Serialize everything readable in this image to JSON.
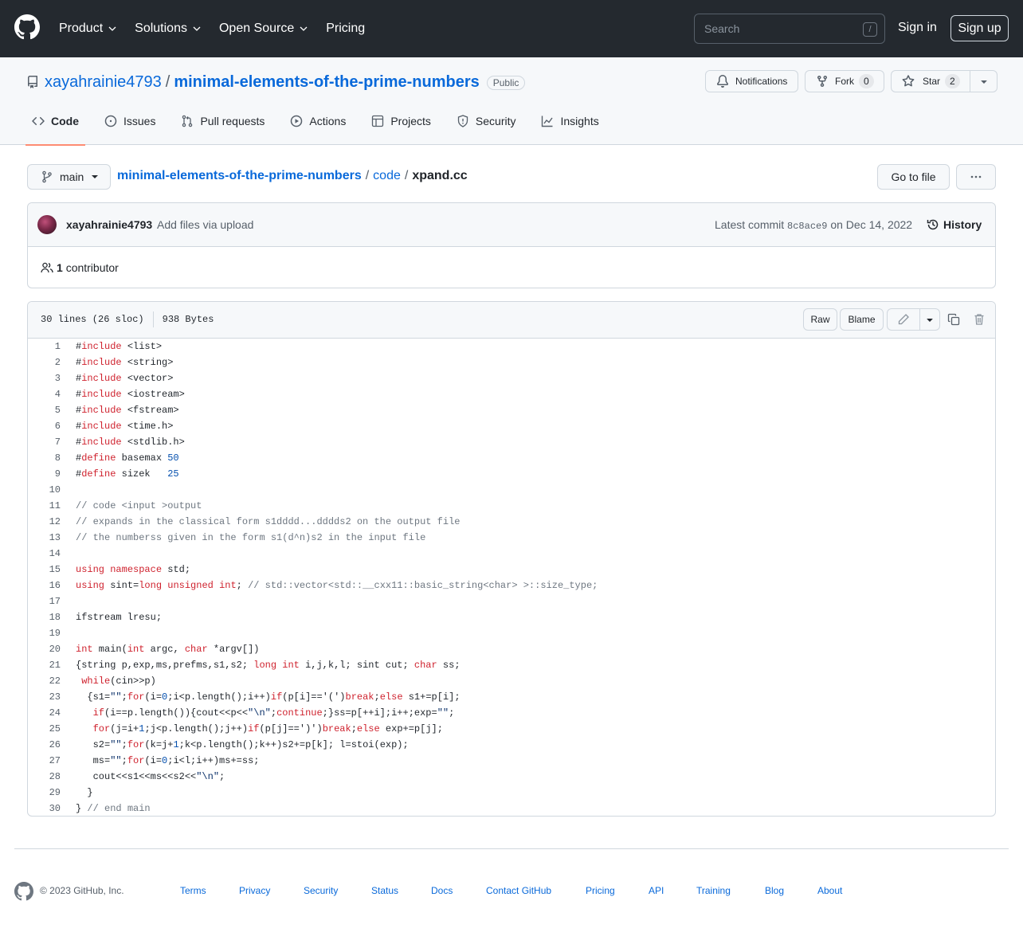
{
  "header": {
    "nav": [
      "Product",
      "Solutions",
      "Open Source",
      "Pricing"
    ],
    "search_placeholder": "Search",
    "search_shortcut": "/",
    "signin": "Sign in",
    "signup": "Sign up"
  },
  "repo": {
    "owner": "xayahrainie4793",
    "separator": "/",
    "name": "minimal-elements-of-the-prime-numbers",
    "visibility": "Public",
    "notifications": "Notifications",
    "fork_label": "Fork",
    "fork_count": "0",
    "star_label": "Star",
    "star_count": "2",
    "tabs": [
      {
        "label": "Code",
        "icon": "code-icon"
      },
      {
        "label": "Issues",
        "icon": "issue-icon"
      },
      {
        "label": "Pull requests",
        "icon": "pull-request-icon"
      },
      {
        "label": "Actions",
        "icon": "play-icon"
      },
      {
        "label": "Projects",
        "icon": "table-icon"
      },
      {
        "label": "Security",
        "icon": "shield-icon"
      },
      {
        "label": "Insights",
        "icon": "graph-icon"
      }
    ]
  },
  "file_nav": {
    "branch": "main",
    "path_repo": "minimal-elements-of-the-prime-numbers",
    "path_dir": "code",
    "path_sep": "/",
    "file_name": "xpand.cc",
    "go_to_file": "Go to file"
  },
  "commit": {
    "author": "xayahrainie4793",
    "message": "Add files via upload",
    "latest_label": "Latest commit",
    "sha": "8c8ace9",
    "date": "on Dec 14, 2022",
    "history": "History",
    "contributors_count": "1",
    "contributors_label": "contributor"
  },
  "code": {
    "lines_info": "30 lines (26 sloc)",
    "size": "938 Bytes",
    "raw": "Raw",
    "blame": "Blame",
    "lines": [
      "#include <list>",
      "#include <string>",
      "#include <vector>",
      "#include <iostream>",
      "#include <fstream>",
      "#include <time.h>",
      "#include <stdlib.h>",
      "#define basemax 50",
      "#define sizek   25",
      "",
      "// code <input >output",
      "// expands in the classical form s1dddd...dddds2 on the output file",
      "// the numberss given in the form s1(d^n)s2 in the input file",
      "",
      "using namespace std;",
      "using sint=long unsigned int; // std::vector<std::__cxx11::basic_string<char> >::size_type;",
      "",
      "ifstream lresu;",
      "",
      "int main(int argc, char *argv[])",
      "{string p,exp,ms,prefms,s1,s2; long int i,j,k,l; sint cut; char ss;",
      " while(cin>>p)",
      "  {s1=\"\";for(i=0;i<p.length();i++)if(p[i]=='(')break;else s1+=p[i];",
      "   if(i==p.length()){cout<<p<<\"\\n\";continue;}ss=p[++i];i++;exp=\"\";",
      "   for(j=i+1;j<p.length();j++)if(p[j]==')')break;else exp+=p[j];",
      "   s2=\"\";for(k=j+1;k<p.length();k++)s2+=p[k]; l=stoi(exp);",
      "   ms=\"\";for(i=0;i<l;i++)ms+=ss;",
      "   cout<<s1<<ms<<s2<<\"\\n\";",
      "  }",
      "} // end main"
    ]
  },
  "footer": {
    "copyright": "© 2023 GitHub, Inc.",
    "links": [
      "Terms",
      "Privacy",
      "Security",
      "Status",
      "Docs",
      "Contact GitHub",
      "Pricing",
      "API",
      "Training",
      "Blog",
      "About"
    ]
  }
}
